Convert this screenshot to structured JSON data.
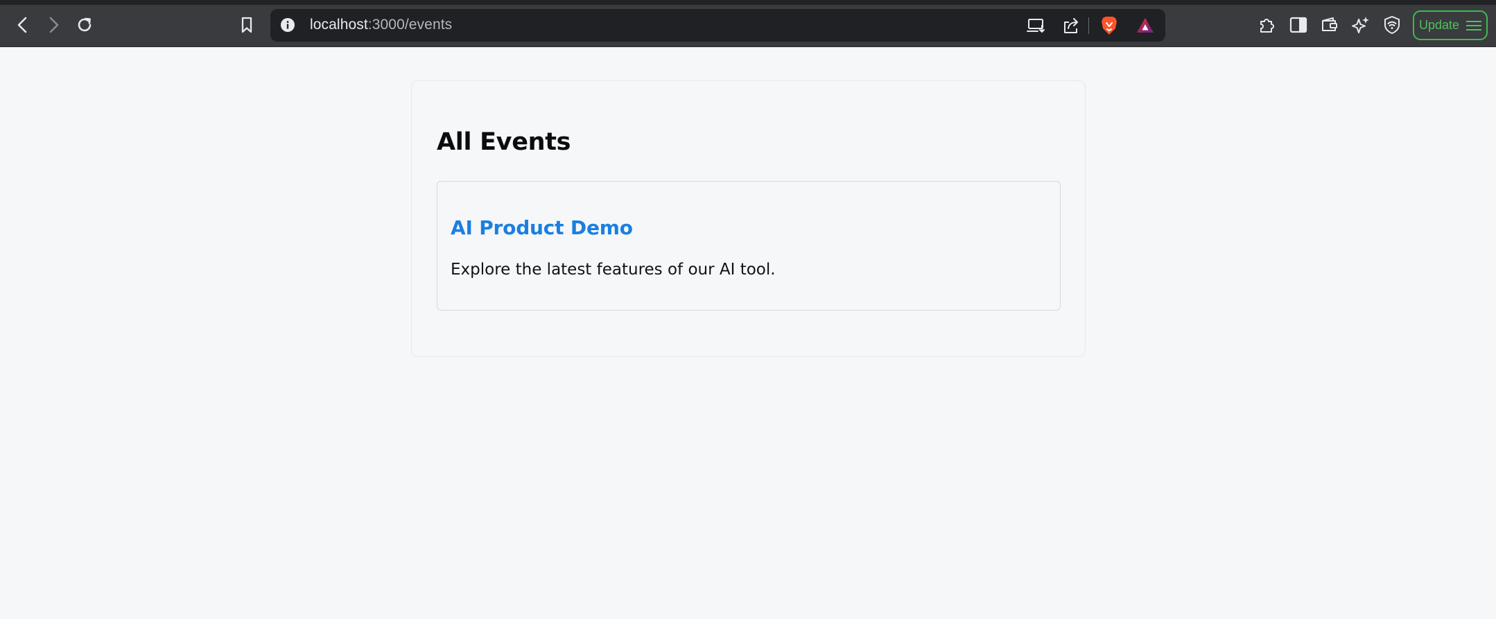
{
  "browser": {
    "url_host": "localhost",
    "url_path": ":3000/events",
    "update_label": "Update",
    "icons": {
      "back": "back-arrow-icon",
      "forward": "forward-arrow-icon",
      "reload": "reload-icon",
      "bookmark": "bookmark-icon",
      "site_info": "info-icon",
      "install": "install-app-icon",
      "share": "share-icon",
      "brave_shields": "brave-lion-icon",
      "brave_rewards": "brave-rewards-icon",
      "extensions": "puzzle-icon",
      "sidebar": "sidebar-icon",
      "wallet": "wallet-icon",
      "leo": "leo-sparkle-icon",
      "vpn": "vpn-shield-icon",
      "menu": "hamburger-menu-icon"
    },
    "colors": {
      "update_accent": "#3fb950",
      "brave_orange": "#fb542b"
    }
  },
  "page": {
    "title": "All Events",
    "events": [
      {
        "title": "AI Product Demo",
        "description": "Explore the latest features of our AI tool."
      }
    ],
    "colors": {
      "link": "#1a7fe0",
      "background": "#f6f7f9"
    }
  }
}
